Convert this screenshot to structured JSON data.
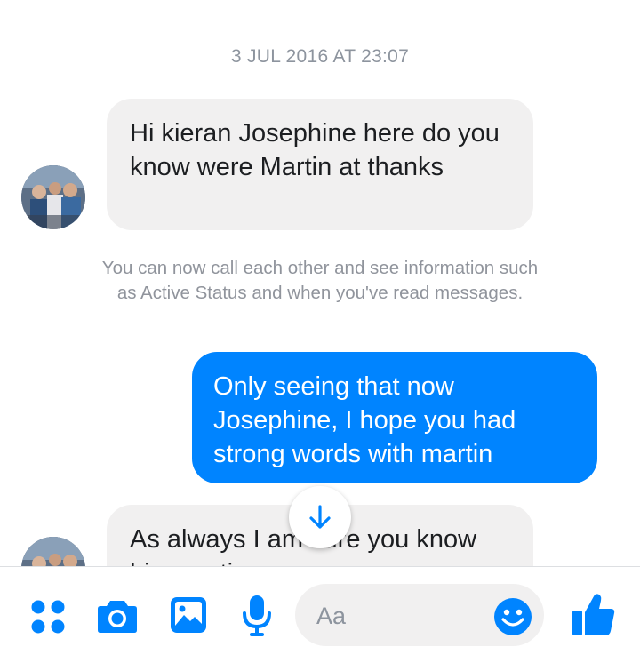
{
  "thread": {
    "timestamp": "3 JUL 2016 AT 23:07",
    "messages": [
      {
        "direction": "incoming",
        "text": "Hi kieran Josephine here do you know were Martin at thanks"
      },
      {
        "direction": "system",
        "text": "You can now call each other and see information such as Active Status and when you've read messages."
      },
      {
        "direction": "outgoing",
        "text": "Only seeing that now Josephine, I hope you had strong words with martin"
      },
      {
        "direction": "incoming",
        "text": "As always I am sure you know his reaction"
      }
    ]
  },
  "composer": {
    "placeholder": "Aa",
    "icons": [
      "apps-icon",
      "camera-icon",
      "gallery-icon",
      "microphone-icon",
      "emoji-icon",
      "thumbs-up-icon"
    ]
  },
  "colors": {
    "accent": "#0084ff",
    "incoming_bubble": "#f1f0f0",
    "system_text": "#90949c"
  }
}
